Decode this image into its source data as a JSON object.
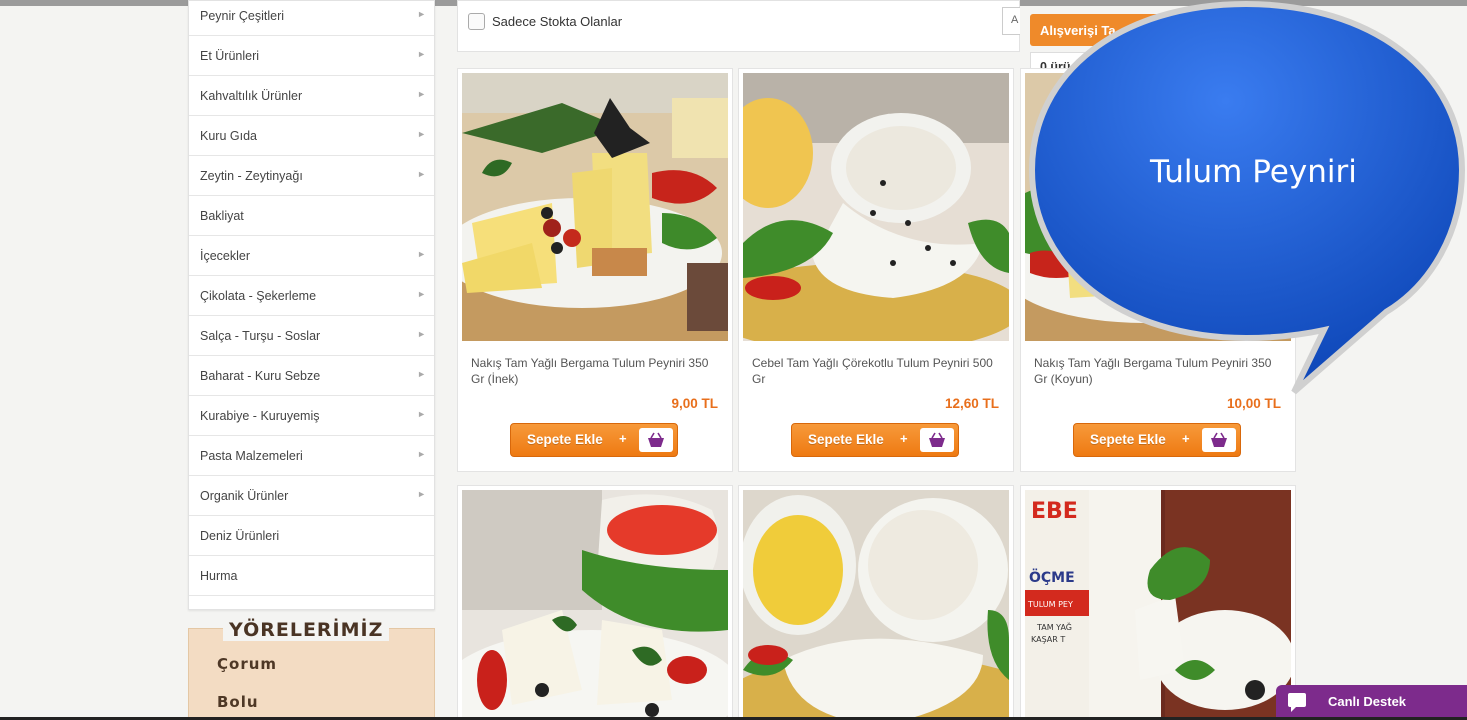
{
  "sidebar": {
    "categories": [
      {
        "label": "Peynir Çeşitleri",
        "has_arrow": true
      },
      {
        "label": "Et Ürünleri",
        "has_arrow": true
      },
      {
        "label": "Kahvaltılık Ürünler",
        "has_arrow": true
      },
      {
        "label": "Kuru Gıda",
        "has_arrow": true
      },
      {
        "label": "Zeytin - Zeytinyağı",
        "has_arrow": true
      },
      {
        "label": "Bakliyat",
        "has_arrow": false
      },
      {
        "label": "İçecekler",
        "has_arrow": true
      },
      {
        "label": "Çikolata - Şekerleme",
        "has_arrow": true
      },
      {
        "label": "Salça - Turşu - Soslar",
        "has_arrow": true
      },
      {
        "label": "Baharat - Kuru Sebze",
        "has_arrow": true
      },
      {
        "label": "Kurabiye - Kuruyemiş",
        "has_arrow": true
      },
      {
        "label": "Pasta Malzemeleri",
        "has_arrow": true
      },
      {
        "label": "Organik Ürünler",
        "has_arrow": true
      },
      {
        "label": "Deniz Ürünleri",
        "has_arrow": false
      },
      {
        "label": "Hurma",
        "has_arrow": false
      }
    ],
    "arrow_glyph": "►"
  },
  "regions": {
    "title": "YÖRELERİMİZ",
    "items": [
      "Çorum",
      "Bolu"
    ]
  },
  "filter": {
    "in_stock_label": "Sadece Stokta Olanlar",
    "sort_value": "A"
  },
  "cart": {
    "button_label": "Alışverişi Ta",
    "count_label": "0 ürü"
  },
  "products": [
    {
      "name": "Nakış Tam Yağlı Bergama Tulum Peyniri 350 Gr (İnek)",
      "price": "9,00 TL",
      "button": "Sepete Ekle",
      "plus": "+"
    },
    {
      "name": "Cebel Tam Yağlı Çörekotlu Tulum Peyniri 500 Gr",
      "price": "12,60 TL",
      "button": "Sepete Ekle",
      "plus": "+"
    },
    {
      "name": "Nakış Tam Yağlı Bergama Tulum Peyniri 350 Gr (Koyun)",
      "price": "10,00 TL",
      "button": "Sepete Ekle",
      "plus": "+"
    }
  ],
  "bubble": {
    "text": "Tulum Peyniri",
    "color": "#1a5fd6"
  },
  "support": {
    "label": "Canlı Destek",
    "color": "#7d2b8c"
  },
  "colors": {
    "accent": "#ee7a12",
    "price": "#e86f1c",
    "basket": "#7d2b8c"
  }
}
